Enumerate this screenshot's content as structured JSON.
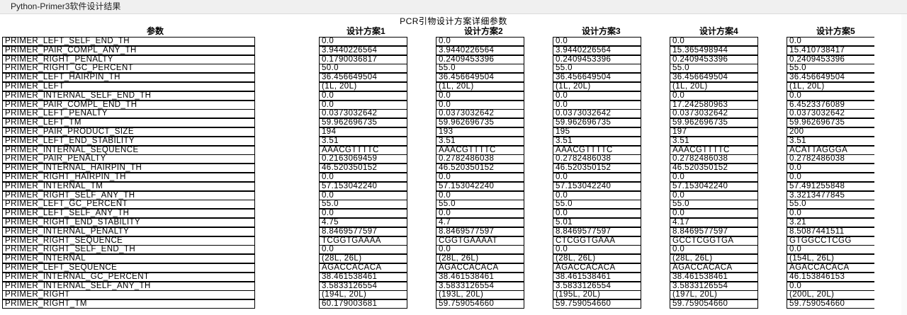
{
  "window": {
    "title": "Python-Primer3软件设计结果"
  },
  "heading": "PCR引物设计方案详细参数",
  "columns": [
    "参数",
    "设计方案1",
    "设计方案2",
    "设计方案3",
    "设计方案4",
    "设计方案5"
  ],
  "rows": [
    [
      "PRIMER_LEFT_SELF_END_TH",
      "0.0",
      "0.0",
      "0.0",
      "0.0",
      "0.0"
    ],
    [
      "PRIMER_PAIR_COMPL_ANY_TH",
      "3.9440226564",
      "3.9440226564",
      "3.9440226564",
      "15.365498944",
      "15.410738417"
    ],
    [
      "PRIMER_RIGHT_PENALTY",
      "0.1790036817",
      "0.2409453396",
      "0.2409453396",
      "0.2409453396",
      "0.2409453396"
    ],
    [
      "PRIMER_RIGHT_GC_PERCENT",
      "50.0",
      "55.0",
      "55.0",
      "55.0",
      "55.0"
    ],
    [
      "PRIMER_LEFT_HAIRPIN_TH",
      "36.456649504",
      "36.456649504",
      "36.456649504",
      "36.456649504",
      "36.456649504"
    ],
    [
      "PRIMER_LEFT",
      "(1L, 20L)",
      "(1L, 20L)",
      "(1L, 20L)",
      "(1L, 20L)",
      "(1L, 20L)"
    ],
    [
      "PRIMER_INTERNAL_SELF_END_TH",
      "0.0",
      "0.0",
      "0.0",
      "0.0",
      "0.0"
    ],
    [
      "PRIMER_PAIR_COMPL_END_TH",
      "0.0",
      "0.0",
      "0.0",
      "17.242580963",
      "6.4523376089"
    ],
    [
      "PRIMER_LEFT_PENALTY",
      "0.0373032642",
      "0.0373032642",
      "0.0373032642",
      "0.0373032642",
      "0.0373032642"
    ],
    [
      "PRIMER_LEFT_TM",
      "59.962696735",
      "59.962696735",
      "59.962696735",
      "59.962696735",
      "59.962696735"
    ],
    [
      "PRIMER_PAIR_PRODUCT_SIZE",
      "194",
      "193",
      "195",
      "197",
      "200"
    ],
    [
      "PRIMER_LEFT_END_STABILITY",
      "3.51",
      "3.51",
      "3.51",
      "3.51",
      "3.51"
    ],
    [
      "PRIMER_INTERNAL_SEQUENCE",
      "AAACGTTTTC",
      "AAACGTTTTC",
      "AAACGTTTTC",
      "AAACGTTTTC",
      "ACATTAGGGA"
    ],
    [
      "PRIMER_PAIR_PENALTY",
      "0.2163069459",
      "0.2782486038",
      "0.2782486038",
      "0.2782486038",
      "0.2782486038"
    ],
    [
      "PRIMER_INTERNAL_HAIRPIN_TH",
      "46.520350152",
      "46.520350152",
      "46.520350152",
      "46.520350152",
      "0.0"
    ],
    [
      "PRIMER_RIGHT_HAIRPIN_TH",
      "0.0",
      "0.0",
      "0.0",
      "0.0",
      "0.0"
    ],
    [
      "PRIMER_INTERNAL_TM",
      "57.153042240",
      "57.153042240",
      "57.153042240",
      "57.153042240",
      "57.491255848"
    ],
    [
      "PRIMER_RIGHT_SELF_ANY_TH",
      "0.0",
      "0.0",
      "0.0",
      "0.0",
      "3.3213477845"
    ],
    [
      "PRIMER_LEFT_GC_PERCENT",
      "55.0",
      "55.0",
      "55.0",
      "55.0",
      "55.0"
    ],
    [
      "PRIMER_LEFT_SELF_ANY_TH",
      "0.0",
      "0.0",
      "0.0",
      "0.0",
      "0.0"
    ],
    [
      "PRIMER_RIGHT_END_STABILITY",
      "4.75",
      "4.7",
      "5.01",
      "4.17",
      "3.21"
    ],
    [
      "PRIMER_INTERNAL_PENALTY",
      "8.8469577597",
      "8.8469577597",
      "8.8469577597",
      "8.8469577597",
      "8.5087441511"
    ],
    [
      "PRIMER_RIGHT_SEQUENCE",
      "TCGGTGAAAA",
      "CGGTGAAAAT",
      "CTCGGTGAAA",
      "GCCTCGGTGA",
      "GTGGCCTCGG"
    ],
    [
      "PRIMER_RIGHT_SELF_END_TH",
      "0.0",
      "0.0",
      "0.0",
      "0.0",
      "0.0"
    ],
    [
      "PRIMER_INTERNAL",
      "(28L, 26L)",
      "(28L, 26L)",
      "(28L, 26L)",
      "(28L, 26L)",
      "(154L, 26L)"
    ],
    [
      "PRIMER_LEFT_SEQUENCE",
      "AGACCACACA",
      "AGACCACACA",
      "AGACCACACA",
      "AGACCACACA",
      "AGACCACACA"
    ],
    [
      "PRIMER_INTERNAL_GC_PERCENT",
      "38.461538461",
      "38.461538461",
      "38.461538461",
      "38.461538461",
      "46.153846153"
    ],
    [
      "PRIMER_INTERNAL_SELF_ANY_TH",
      "3.5833126554",
      "3.5833126554",
      "3.5833126554",
      "3.5833126554",
      "0.0"
    ],
    [
      "PRIMER_RIGHT",
      "(194L, 20L)",
      "(193L, 20L)",
      "(195L, 20L)",
      "(197L, 20L)",
      "(200L, 20L)"
    ],
    [
      "PRIMER_RIGHT_TM",
      "60.179003681",
      "59.759054660",
      "59.759054660",
      "59.759054660",
      "59.759054660"
    ]
  ]
}
